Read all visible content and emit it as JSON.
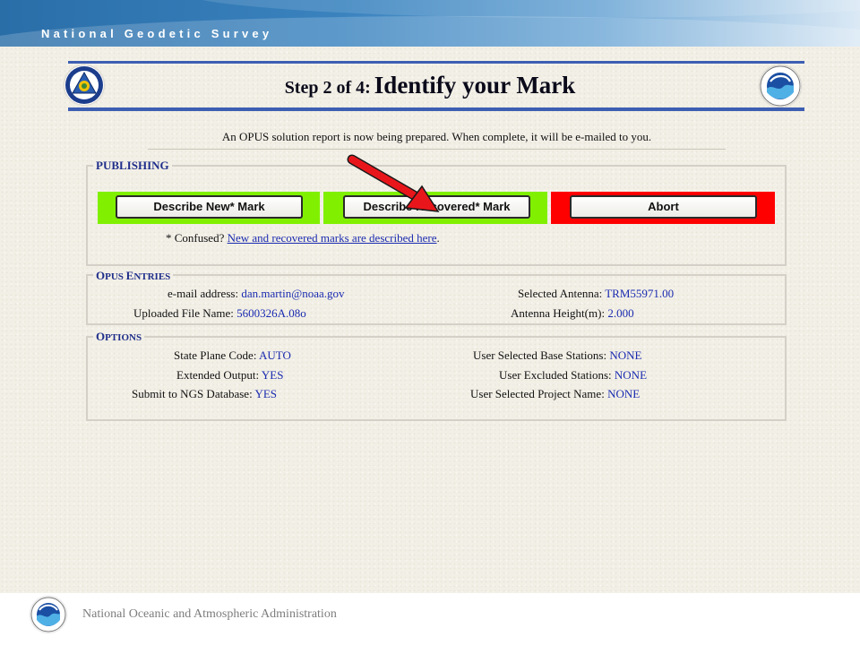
{
  "banner": {
    "title": "National Geodetic Survey"
  },
  "header": {
    "step": "Step 2 of 4:",
    "title": "Identify your Mark",
    "left_logo": "ngs-seal-icon",
    "right_logo": "noaa-logo-icon"
  },
  "notice": "An OPUS solution report is now being prepared. When complete, it will be e-mailed to you.",
  "publishing": {
    "legend": "PUBLISHING",
    "buttons": {
      "new": "Describe New* Mark",
      "recovered": "Describe Recovered* Mark",
      "abort": "Abort"
    },
    "band_colors": {
      "new": "#80f000",
      "recovered": "#80f000",
      "abort": "#ff0000"
    },
    "confused_prefix": "* Confused?",
    "confused_link": "New and recovered marks are described here",
    "confused_suffix": "."
  },
  "entries": {
    "legend_first": "O",
    "legend_rest": "PUS ",
    "legend_first2": "E",
    "legend_rest2": "NTRIES",
    "email_label": "e-mail address:",
    "email_value": "dan.martin@noaa.gov",
    "file_label": "Uploaded File Name:",
    "file_value": "5600326A.08o",
    "antenna_label": "Selected Antenna:",
    "antenna_value": "TRM55971.00",
    "height_label": "Antenna Height(m):",
    "height_value": "2.000"
  },
  "options": {
    "legend_first": "O",
    "legend_rest": "PTIONS",
    "spc_label": "State Plane Code:",
    "spc_value": "AUTO",
    "ext_label": "Extended Output:",
    "ext_value": "YES",
    "db_label": "Submit to NGS Database:",
    "db_value": "YES",
    "base_label": "User Selected Base Stations:",
    "base_value": "NONE",
    "excl_label": "User Excluded Stations:",
    "excl_value": "NONE",
    "proj_label": "User Selected Project Name:",
    "proj_value": "NONE"
  },
  "annotation": {
    "arrow_color": "#e8161b",
    "arrow_icon": "red-arrow-icon"
  },
  "footer": {
    "text": "National Oceanic and Atmospheric Administration",
    "logo": "noaa-logo-icon"
  },
  "colors": {
    "link": "#1a2bb0",
    "legend": "#1f2e8a",
    "rule": "#3d5fb3",
    "background": "#f2efe6"
  }
}
